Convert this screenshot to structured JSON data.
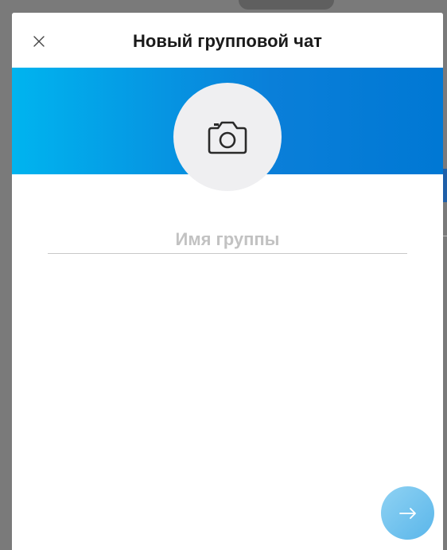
{
  "dialog": {
    "title": "Новый групповой чат",
    "close_icon": "close-icon",
    "photo_icon": "camera-icon",
    "group_name_placeholder": "Имя группы",
    "group_name_value": "",
    "next_icon": "arrow-right-icon"
  },
  "colors": {
    "banner_start": "#00b4ef",
    "banner_end": "#0078d4",
    "next_button": "#6cc0ee"
  }
}
